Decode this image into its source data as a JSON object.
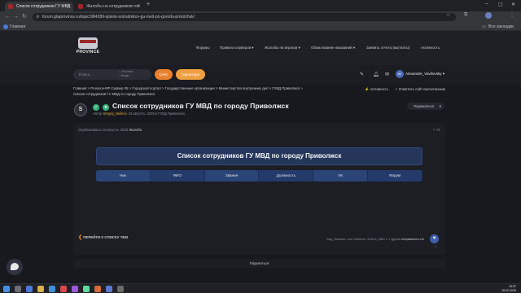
{
  "browser": {
    "tabs": [
      {
        "label": "Список сотрудников ГУ МВД",
        "active": true
      },
      {
        "label": "Жалобы на сотрудников гос",
        "active": false
      }
    ],
    "new_tab": "+",
    "url": "forum.gtaprovince.ru/topic/984289-spisok-sotrudnikov-gu-mvd-po-gorodu-privolzhsk/",
    "bookmark": "Главная",
    "all_bookmarks": "Все закладки"
  },
  "header": {
    "logo_text": "PROVINCE",
    "nav": [
      "Форумы",
      "Правила серверов",
      "Жалобы на игроков",
      "Обжалование наказаний",
      "Заявить отчета (выплаты)",
      "Активность"
    ],
    "search_placeholder": "Поиск...",
    "search_options": [
      "Эта тема",
      "Везде"
    ],
    "login_label": "Сеяс",
    "signup_label": "Гарнитура",
    "user_name": "Alexander_Vavilovsky",
    "user_initials": "AV"
  },
  "breadcrumbs": {
    "path": "Главная > Province-RP Сервер #5 > Городской портал > Государственные организации > Министерство внутренних дел > ГУВД Приволжск >",
    "current": "Список сотрудников ГУ МВД по городу Приволжск"
  },
  "top_actions": {
    "activity": "Активность",
    "mark_read": "Отметить сайт прочитанным"
  },
  "thread": {
    "avatar_letter": "S",
    "title": "Список сотрудников ГУ МВД по городу Приволжск",
    "author_prefix": "Автор",
    "author": "Sergey_Belikov",
    "meta_rest": ", 23 августа, 2025 в ГУВД Приволжск",
    "subscribe_label": "Подписаться",
    "subscribe_count": "6"
  },
  "post": {
    "published": "Опубликовано 23 августа, 2025",
    "edited": "Жалоба",
    "number": "#1",
    "banner_title": "Список сотрудников ГУ МВД по городу Приволжск",
    "columns": [
      "Ник",
      "ФИО",
      "Звание",
      "Должность",
      "VK",
      "Форум"
    ],
    "reactions_names": "Бад_Фальсин, Luis Fartlenno, Sharon_Miller",
    "reactions_suffix": "и 7 другим",
    "reactions_link": "понравилось это",
    "reaction_count": "1"
  },
  "footer": {
    "back_label": "ПЕРЕЙТИ К СПИСКУ ТЕМ",
    "share_label": "Поделиться"
  },
  "taskbar": {
    "time": "19:57",
    "date": "15.02.2026"
  },
  "colors": {
    "accent": "#e8812f",
    "banner": "#26365a",
    "columns": "#243a6b"
  }
}
